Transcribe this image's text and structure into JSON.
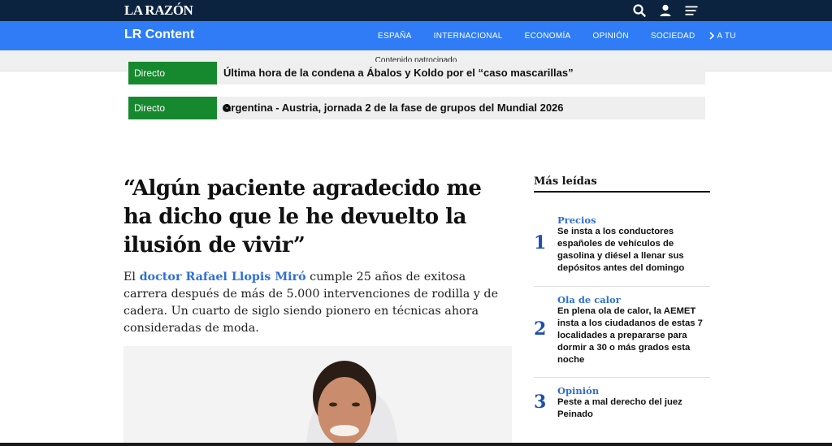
{
  "header": {
    "logo": "LA RAZÓN",
    "icons": [
      "search-icon",
      "user-icon",
      "menu-icon"
    ],
    "colors": {
      "topbar": "#0c2340",
      "navbar": "#2f7cf6"
    }
  },
  "nav": {
    "section_title": "LR Content",
    "items": [
      "ESPAÑA",
      "INTERNACIONAL",
      "ECONOMÍA",
      "OPINIÓN",
      "SOCIEDAD",
      "A TU"
    ]
  },
  "sponsor": {
    "label": "Contenido patrocinado"
  },
  "live": [
    {
      "badge": "Directo",
      "text": "Última hora de la condena a Ábalos y Koldo por el “caso mascarillas”"
    },
    {
      "badge": "Directo",
      "text": "Argentina - Austria, jornada 2 de la fase de grupos del Mundial 2026"
    }
  ],
  "article": {
    "headline": "“Algún paciente agradecido me ha dicho que le he devuelto la ilusión de vivir”",
    "lede_prefix": "El ",
    "lede_link": "doctor Rafael Llopis Miró",
    "lede_rest": " cumple 25 años de exitosa carrera después de más de 5.000 intervenciones de rodilla y de cadera. Un cuarto de siglo siendo pionero en técnicas ahora consideradas de moda."
  },
  "most_read": {
    "title": "Más leídas",
    "items": [
      {
        "number": "1",
        "category": "Precios",
        "text": "Se insta a los conductores españoles de vehículos de gasolina y diésel a llenar sus depósitos antes del domingo"
      },
      {
        "number": "2",
        "category": "Ola de calor",
        "text": "En plena ola de calor, la AEMET insta a los ciudadanos de estas 7 localidades a prepararse para dormir a 30 o más grados esta noche"
      },
      {
        "number": "3",
        "category": "Opinión",
        "text": "Peste a mal derecho del juez Peinado"
      }
    ]
  }
}
